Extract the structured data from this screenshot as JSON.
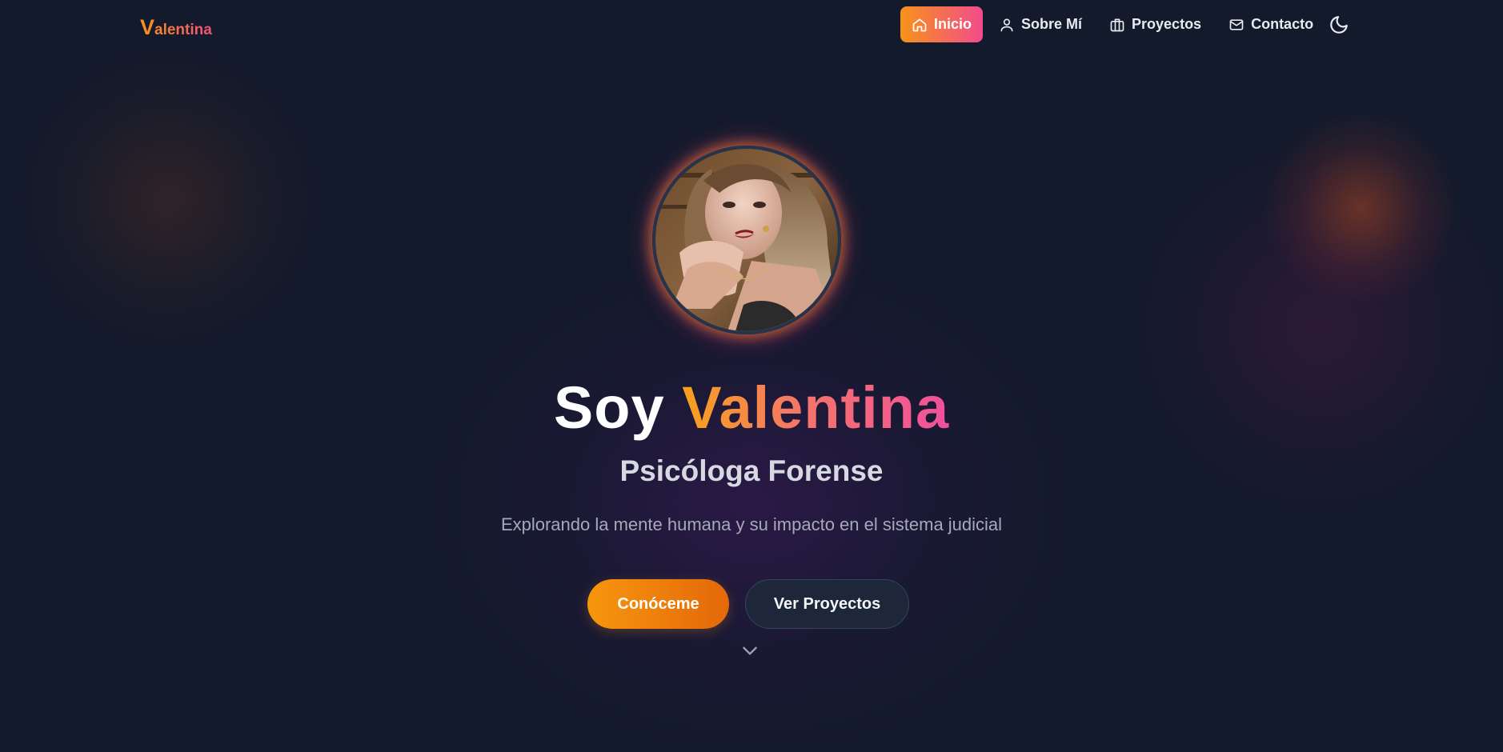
{
  "brand": {
    "initial": "V",
    "rest": "alentina"
  },
  "nav": {
    "items": [
      {
        "label": "Inicio",
        "icon": "home-icon",
        "active": true
      },
      {
        "label": "Sobre Mí",
        "icon": "user-icon",
        "active": false
      },
      {
        "label": "Proyectos",
        "icon": "briefcase-icon",
        "active": false
      },
      {
        "label": "Contacto",
        "icon": "mail-icon",
        "active": false
      }
    ],
    "theme_toggle_icon": "moon-icon"
  },
  "hero": {
    "avatar_icon": "profile-photo",
    "title_prefix": "Soy ",
    "title_name": "Valentina",
    "subtitle": "Psicóloga Forense",
    "description": "Explorando la mente humana y su impacto en el sistema judicial",
    "primary_button": "Conóceme",
    "secondary_button": "Ver Proyectos",
    "scroll_icon": "chevron-down-icon"
  },
  "colors": {
    "background": "#131a2b",
    "accent_orange": "#f7931a",
    "accent_pink": "#f24b8c",
    "secondary_button_bg": "#1d2739"
  }
}
